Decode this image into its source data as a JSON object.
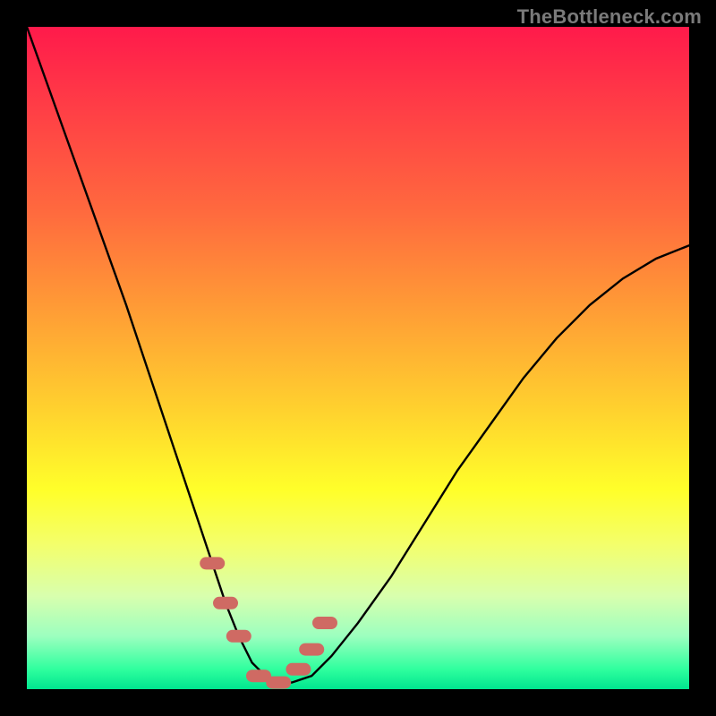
{
  "watermark": "TheBottleneck.com",
  "colors": {
    "background": "#000000",
    "curve": "#000000",
    "marker": "#cf6a63",
    "watermark": "#7a7a7a",
    "gradient_stops": [
      "#ff1a4b",
      "#ff3d46",
      "#ff6a3e",
      "#ff9a36",
      "#ffd22e",
      "#ffff2a",
      "#f4ff6a",
      "#d8ffae",
      "#9cffbf",
      "#2fff9e",
      "#00e58f"
    ]
  },
  "chart_data": {
    "type": "line",
    "title": "",
    "xlabel": "",
    "ylabel": "",
    "xlim": [
      0,
      100
    ],
    "ylim": [
      0,
      100
    ],
    "grid": false,
    "legend": false,
    "series": [
      {
        "name": "bottleneck-curve",
        "x": [
          0,
          5,
          10,
          15,
          20,
          25,
          28,
          30,
          32,
          34,
          36,
          38,
          40,
          43,
          46,
          50,
          55,
          60,
          65,
          70,
          75,
          80,
          85,
          90,
          95,
          100
        ],
        "y": [
          100,
          86,
          72,
          58,
          43,
          28,
          19,
          13,
          8,
          4,
          2,
          1,
          1,
          2,
          5,
          10,
          17,
          25,
          33,
          40,
          47,
          53,
          58,
          62,
          65,
          67
        ]
      }
    ],
    "markers": {
      "name": "highlighted-segment",
      "x": [
        28,
        30,
        32,
        35,
        38,
        41,
        43,
        45
      ],
      "y": [
        19,
        13,
        8,
        2,
        1,
        3,
        6,
        10
      ]
    },
    "annotations": [
      {
        "text": "TheBottleneck.com",
        "position": "top-right"
      }
    ]
  }
}
